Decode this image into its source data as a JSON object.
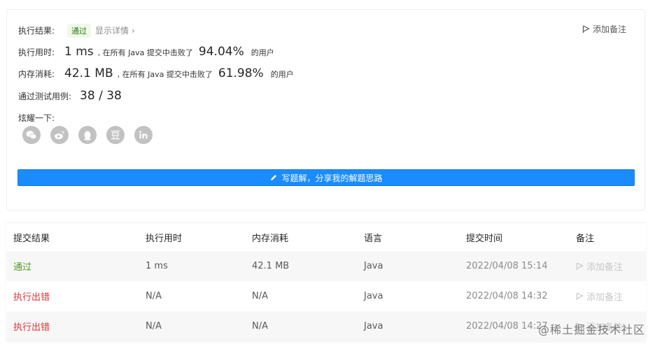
{
  "result": {
    "label": "执行结果:",
    "status": "通过",
    "detail_link": "显示详情 ›",
    "add_note": "添加备注"
  },
  "runtime": {
    "label": "执行用时:",
    "value": "1 ms",
    "mid": ", 在所有 Java 提交中击败了",
    "percent": "94.04%",
    "suffix": "的用户"
  },
  "memory": {
    "label": "内存消耗:",
    "value": "42.1 MB",
    "mid": ", 在所有 Java 提交中击败了",
    "percent": "61.98%",
    "suffix": "的用户"
  },
  "tests": {
    "label": "通过测试用例:",
    "value": "38 / 38"
  },
  "share": {
    "label": "炫耀一下:",
    "icons": [
      "wechat-icon",
      "weibo-icon",
      "qq-icon",
      "douban-icon",
      "linkedin-icon"
    ]
  },
  "write_button": "写题解，分享我的解题思路",
  "table": {
    "headers": [
      "提交结果",
      "执行用时",
      "内存消耗",
      "语言",
      "提交时间",
      "备注"
    ],
    "rows": [
      {
        "result": "通过",
        "time": "1 ms",
        "memory": "42.1 MB",
        "lang": "Java",
        "submitted": "2022/04/08 15:14",
        "note": "添加备注",
        "status": "pass"
      },
      {
        "result": "执行出错",
        "time": "N/A",
        "memory": "N/A",
        "lang": "Java",
        "submitted": "2022/04/08 14:32",
        "note": "添加备注",
        "status": "error"
      },
      {
        "result": "执行出错",
        "time": "N/A",
        "memory": "N/A",
        "lang": "Java",
        "submitted": "2022/04/08 14:27",
        "note": "添加备注",
        "status": "error"
      }
    ]
  },
  "watermark": "@稀土掘金技术社区",
  "colors": {
    "pass": "#4c9f24",
    "error": "#d9363e",
    "primary": "#1a8cff"
  }
}
